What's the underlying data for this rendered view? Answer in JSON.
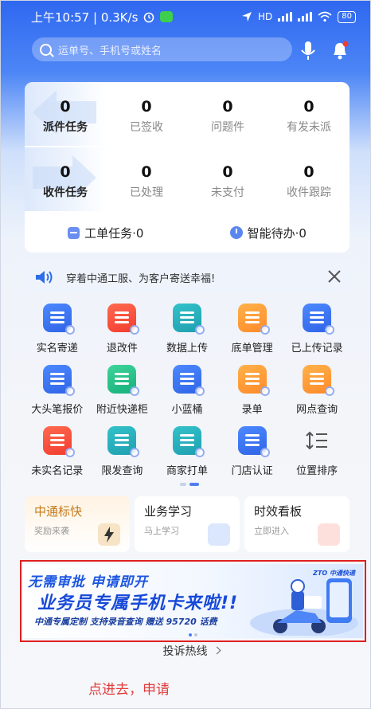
{
  "status_bar": {
    "time_speed": "上午10:57 | 0.3K/s",
    "battery": "80",
    "signal_label": "HD"
  },
  "search": {
    "placeholder": "运单号、手机号或姓名"
  },
  "stats": {
    "row1": [
      {
        "value": "0",
        "label": "派件任务"
      },
      {
        "value": "0",
        "label": "已签收"
      },
      {
        "value": "0",
        "label": "问题件"
      },
      {
        "value": "0",
        "label": "有发未派"
      }
    ],
    "row2": [
      {
        "value": "0",
        "label": "收件任务"
      },
      {
        "value": "0",
        "label": "已处理"
      },
      {
        "value": "0",
        "label": "未支付"
      },
      {
        "value": "0",
        "label": "收件跟踪"
      }
    ]
  },
  "footer_tasks": {
    "work_order": "工单任务·0",
    "smart_todo": "智能待办·0"
  },
  "notice": {
    "text": "穿着中通工服、为客户寄送幸福!"
  },
  "grid": [
    [
      {
        "label": "实名寄递",
        "icon": "user-check-icon",
        "color": "blue"
      },
      {
        "label": "退改件",
        "icon": "return-icon",
        "color": "red"
      },
      {
        "label": "数据上传",
        "icon": "cloud-upload-icon",
        "color": "teal"
      },
      {
        "label": "底单管理",
        "icon": "document-icon",
        "color": "orange"
      },
      {
        "label": "已上传记录",
        "icon": "record-icon",
        "color": "blue"
      }
    ],
    [
      {
        "label": "大头笔报价",
        "icon": "pen-price-icon",
        "color": "blue"
      },
      {
        "label": "附近快递柜",
        "icon": "locker-icon",
        "color": "green"
      },
      {
        "label": "小蓝桶",
        "icon": "bucket-icon",
        "color": "blue"
      },
      {
        "label": "录单",
        "icon": "entry-icon",
        "color": "orange"
      },
      {
        "label": "网点查询",
        "icon": "outlet-search-icon",
        "color": "orange"
      }
    ],
    [
      {
        "label": "未实名记录",
        "icon": "user-warning-icon",
        "color": "red"
      },
      {
        "label": "限发查询",
        "icon": "restrict-icon",
        "color": "teal"
      },
      {
        "label": "商家打单",
        "icon": "printer-icon",
        "color": "teal"
      },
      {
        "label": "门店认证",
        "icon": "store-icon",
        "color": "blue"
      },
      {
        "label": "位置排序",
        "icon": "sort-icon",
        "color": "gray"
      }
    ]
  ],
  "cards": [
    {
      "title": "中通标快",
      "subtitle": "奖励来袭"
    },
    {
      "title": "业务学习",
      "subtitle": "马上学习"
    },
    {
      "title": "时效看板",
      "subtitle": "立即进入"
    }
  ],
  "banner": {
    "line1": "无需审批  申请即开",
    "line2": "业务员专属手机卡来啦!!",
    "line3": "中通专属定制  支持录音查询  赠送 95720 话费",
    "logo_text": "ZTO 中通快递"
  },
  "hotline": {
    "label": "投诉热线"
  },
  "annotation": {
    "text": "点进去，申请"
  },
  "colors": {
    "primary": "#2f68f0",
    "highlight_box": "#e02020",
    "annotation": "#e23b3b"
  }
}
